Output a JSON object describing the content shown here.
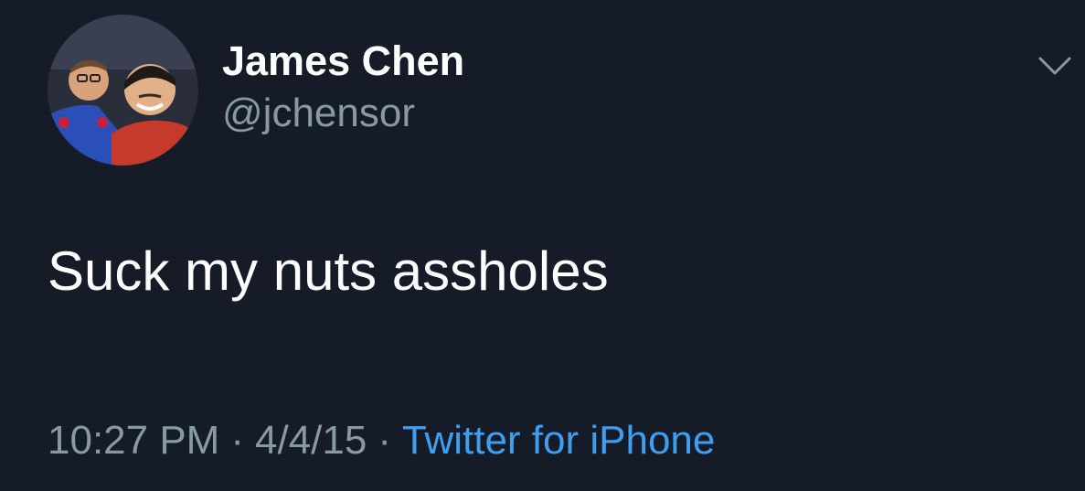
{
  "author": {
    "display_name": "James Chen",
    "handle": "@jchensor",
    "avatar_icon": "profile-photo"
  },
  "tweet": {
    "text": "Suck my nuts assholes"
  },
  "meta": {
    "time": "10:27 PM",
    "separator": "·",
    "date": "4/4/15",
    "source": "Twitter for iPhone"
  },
  "menu": {
    "icon": "chevron-down-icon"
  },
  "colors": {
    "background": "#151c28",
    "primary_text": "#ffffff",
    "secondary_text": "#8899a6",
    "link": "#3e9ef0"
  }
}
